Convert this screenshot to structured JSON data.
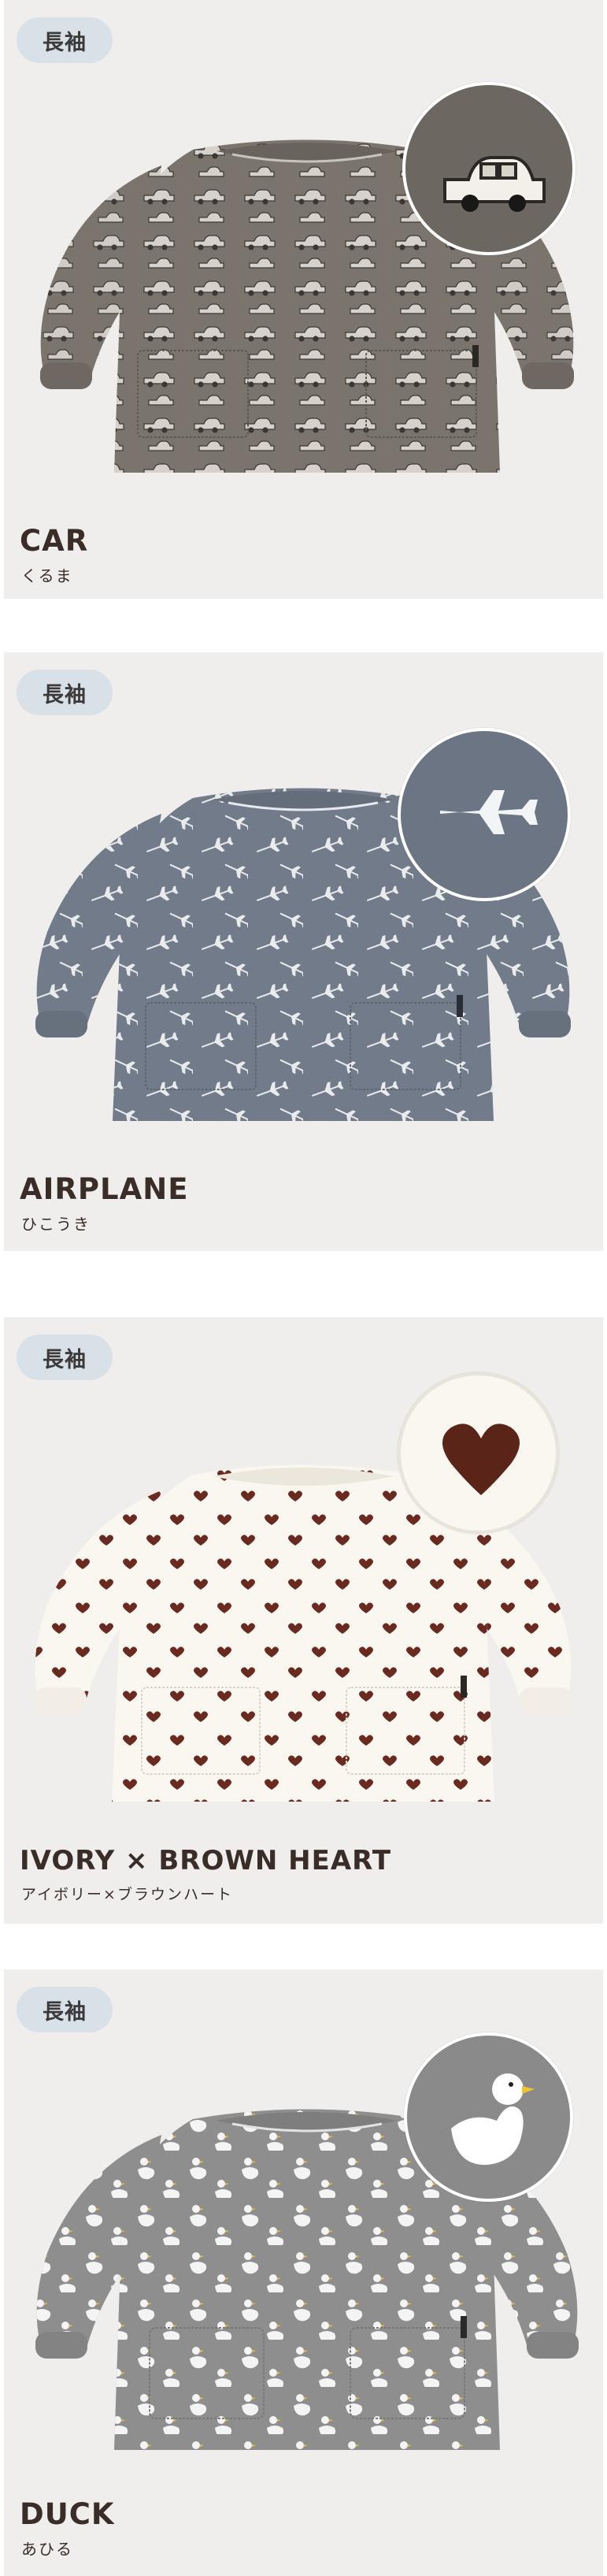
{
  "products": [
    {
      "badge": "長袖",
      "name": "CAR",
      "kana": "くるま",
      "fabric_color": "#7b746d",
      "motif": "car-icon"
    },
    {
      "badge": "長袖",
      "name": "AIRPLANE",
      "kana": "ひこうき",
      "fabric_color": "#727b89",
      "motif": "airplane-icon"
    },
    {
      "badge": "長袖",
      "name": "IVORY × BROWN HEART",
      "kana": "アイボリー×ブラウンハート",
      "fabric_color": "#faf7f1",
      "motif": "heart-icon"
    },
    {
      "badge": "長袖",
      "name": "DUCK",
      "kana": "あひる",
      "fabric_color": "#8e8e8e",
      "motif": "duck-icon"
    }
  ]
}
